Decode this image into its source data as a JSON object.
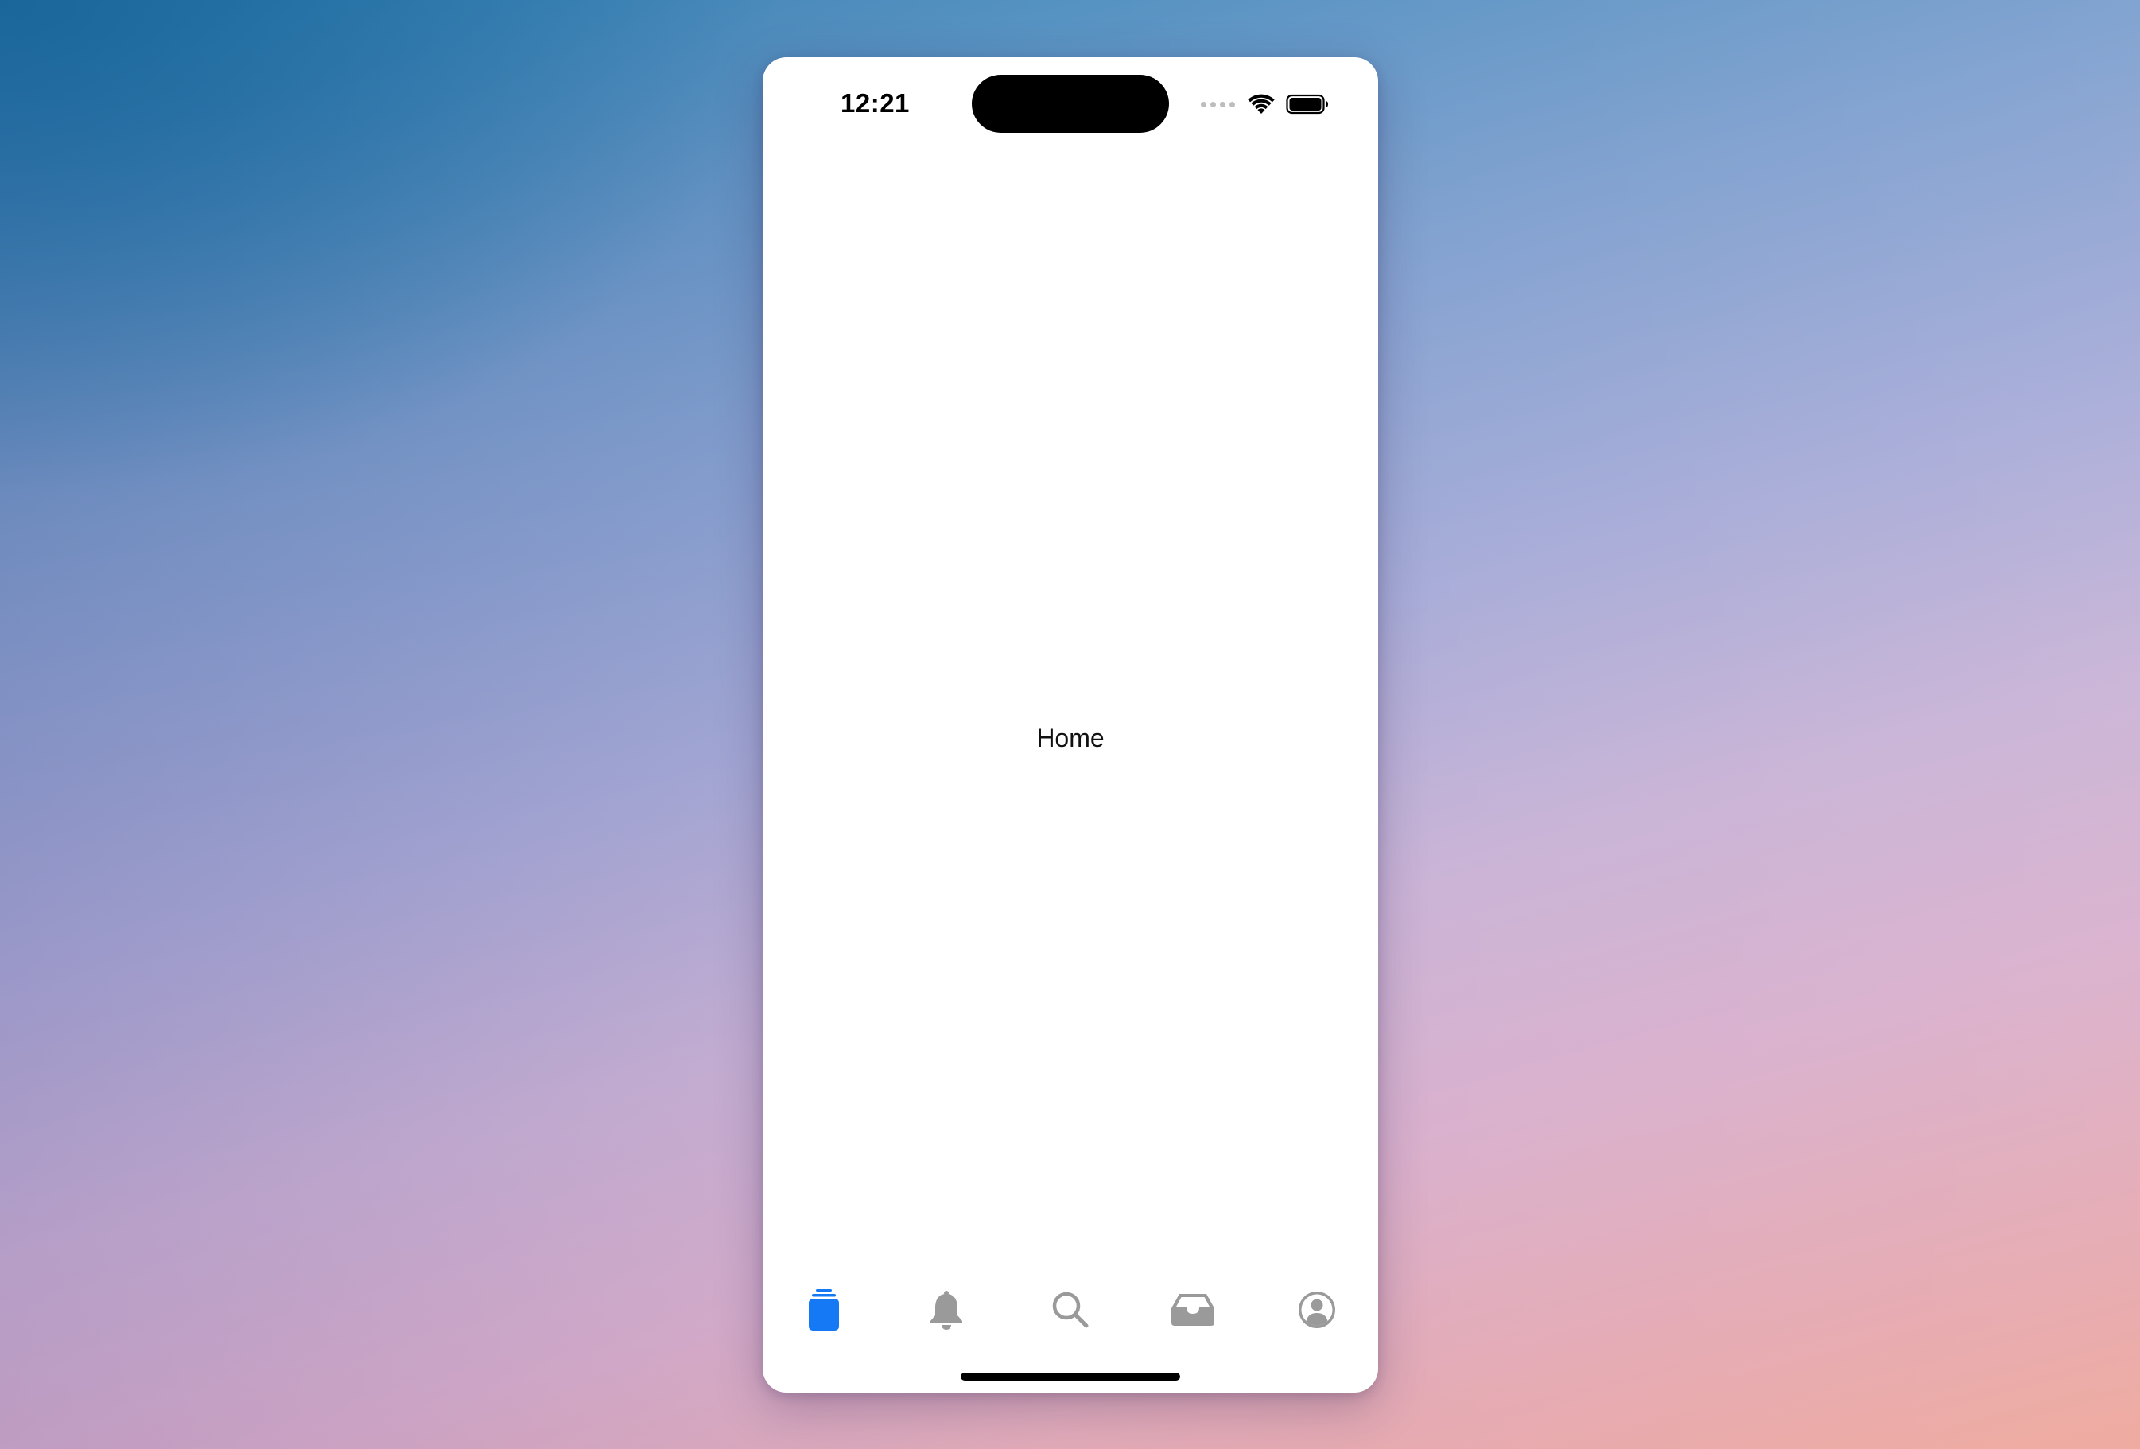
{
  "status_bar": {
    "time": "12:21",
    "icons": [
      "cellular-signal-icon",
      "wifi-icon",
      "battery-icon"
    ]
  },
  "main": {
    "label": "Home"
  },
  "tab_bar": {
    "items": [
      {
        "icon": "home-stack-icon",
        "selected": true
      },
      {
        "icon": "bell-icon",
        "selected": false
      },
      {
        "icon": "search-icon",
        "selected": false
      },
      {
        "icon": "inbox-icon",
        "selected": false
      },
      {
        "icon": "profile-icon",
        "selected": false
      }
    ]
  },
  "colors": {
    "accent": "#1579f6",
    "inactive_icon": "#9a9a9a",
    "background": "#ffffff"
  }
}
